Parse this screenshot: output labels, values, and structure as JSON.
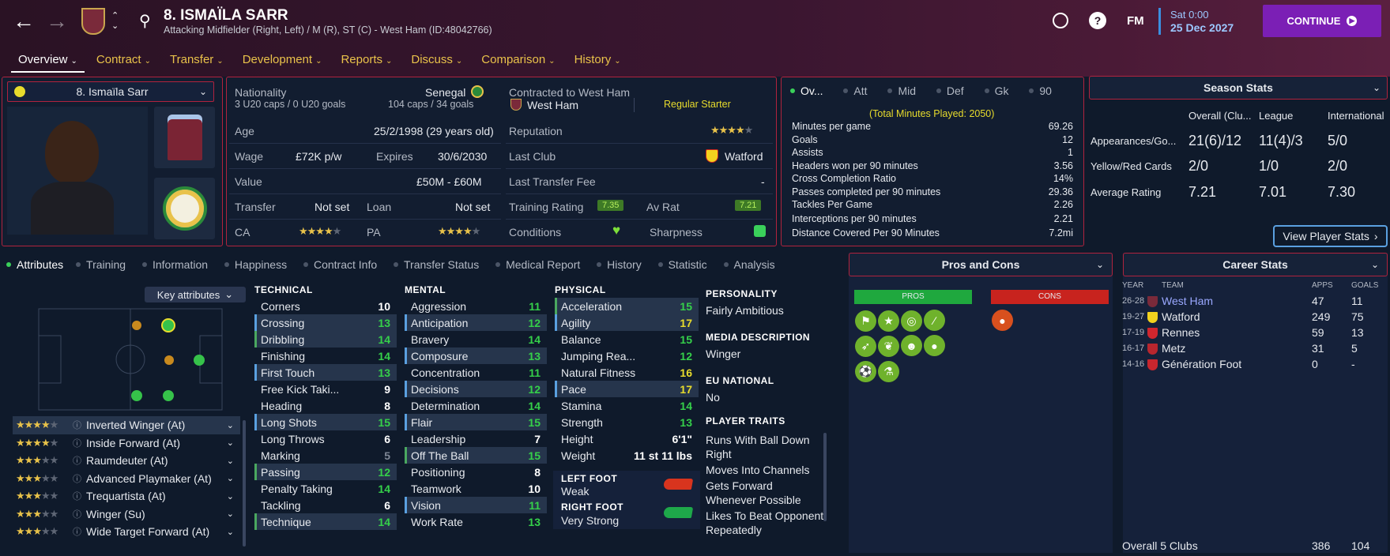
{
  "header": {
    "name": "8. ISMAÏLA SARR",
    "subtitle": "Attacking Midfielder (Right, Left) / M (R), ST (C) - West Ham (ID:48042766)",
    "fm_label": "FM",
    "date_line1": "Sat 0:00",
    "date_line2": "25 Dec 2027",
    "continue_label": "CONTINUE"
  },
  "menu": [
    {
      "label": "Overview"
    },
    {
      "label": "Contract"
    },
    {
      "label": "Transfer"
    },
    {
      "label": "Development"
    },
    {
      "label": "Reports"
    },
    {
      "label": "Discuss"
    },
    {
      "label": "Comparison"
    },
    {
      "label": "History"
    }
  ],
  "profile": {
    "select_label": "8. Ismaïla Sarr",
    "nationality_label": "Nationality",
    "nationality": "Senegal",
    "u20": "3 U20 caps / 0 U20 goals",
    "caps": "104 caps / 34 goals",
    "contracted_label": "Contracted to West Ham",
    "club": "West Ham",
    "squad_status": "Regular Starter",
    "age_label": "Age",
    "age": "25/2/1998 (29 years old)",
    "reputation_label": "Reputation",
    "wage_label": "Wage",
    "wage": "£72K p/w",
    "expires_label": "Expires",
    "expires": "30/6/2030",
    "lastclub_label": "Last Club",
    "lastclub": "Watford",
    "value_label": "Value",
    "value": "£50M - £60M",
    "lastfee_label": "Last Transfer Fee",
    "lastfee": "-",
    "transfer_label": "Transfer",
    "transfer": "Not set",
    "loan_label": "Loan",
    "loan": "Not set",
    "training_label": "Training Rating",
    "training": "7.35",
    "avrat_label": "Av Rat",
    "avrat": "7.21",
    "ca_label": "CA",
    "pa_label": "PA",
    "conditions_label": "Conditions",
    "sharpness_label": "Sharpness"
  },
  "overview_stats": {
    "tabs": [
      "Ov...",
      "Att",
      "Mid",
      "Def",
      "Gk",
      "90"
    ],
    "total": "(Total Minutes Played: 2050)",
    "rows": [
      {
        "label": "Minutes per game",
        "value": "69.26"
      },
      {
        "label": "Goals",
        "value": "12"
      },
      {
        "label": "Assists",
        "value": "1"
      },
      {
        "label": "Headers won per 90 minutes",
        "value": "3.56"
      },
      {
        "label": "Cross Completion Ratio",
        "value": "14%"
      },
      {
        "label": "Passes completed per 90 minutes",
        "value": "29.36"
      },
      {
        "label": "Tackles Per Game",
        "value": "2.26"
      },
      {
        "label": "Interceptions per 90 minutes",
        "value": "2.21"
      },
      {
        "label": "Distance Covered Per 90 Minutes",
        "value": "7.2mi"
      }
    ]
  },
  "season_stats": {
    "title": "Season Stats",
    "cols": [
      "Overall (Clu...",
      "League",
      "International"
    ],
    "rows": [
      {
        "label": "Appearances/Go...",
        "v": [
          "21(6)/12",
          "11(4)/3",
          "5/0"
        ]
      },
      {
        "label": "Yellow/Red Cards",
        "v": [
          "2/0",
          "1/0",
          "2/0"
        ]
      },
      {
        "label": "Average Rating",
        "v": [
          "7.21",
          "7.01",
          "7.30"
        ]
      }
    ],
    "button": "View Player Stats"
  },
  "subtabs": [
    "Attributes",
    "Training",
    "Information",
    "Happiness",
    "Contract Info",
    "Transfer Status",
    "Medical Report",
    "History",
    "Statistic",
    "Analysis"
  ],
  "key_attributes": "Key attributes",
  "roles": [
    {
      "name": "Inverted Winger (At)",
      "stars": 3.5
    },
    {
      "name": "Inside Forward (At)",
      "stars": 3.5
    },
    {
      "name": "Raumdeuter (At)",
      "stars": 3
    },
    {
      "name": "Advanced Playmaker (At)",
      "stars": 2.5
    },
    {
      "name": "Trequartista (At)",
      "stars": 2.5
    },
    {
      "name": "Winger (Su)",
      "stars": 2.5
    },
    {
      "name": "Wide Target Forward (At)",
      "stars": 2.5
    }
  ],
  "technical": {
    "title": "TECHNICAL",
    "rows": [
      {
        "n": "Corners",
        "v": "10",
        "c": "white",
        "h": ""
      },
      {
        "n": "Crossing",
        "v": "13",
        "c": "green",
        "h": "hb"
      },
      {
        "n": "Dribbling",
        "v": "14",
        "c": "green",
        "h": "hg"
      },
      {
        "n": "Finishing",
        "v": "14",
        "c": "green",
        "h": ""
      },
      {
        "n": "First Touch",
        "v": "13",
        "c": "green",
        "h": "hb"
      },
      {
        "n": "Free Kick Taki...",
        "v": "9",
        "c": "white",
        "h": ""
      },
      {
        "n": "Heading",
        "v": "8",
        "c": "white",
        "h": ""
      },
      {
        "n": "Long Shots",
        "v": "15",
        "c": "green",
        "h": "hb"
      },
      {
        "n": "Long Throws",
        "v": "6",
        "c": "white",
        "h": ""
      },
      {
        "n": "Marking",
        "v": "5",
        "c": "grey",
        "h": ""
      },
      {
        "n": "Passing",
        "v": "12",
        "c": "green",
        "h": "hg"
      },
      {
        "n": "Penalty Taking",
        "v": "14",
        "c": "green",
        "h": ""
      },
      {
        "n": "Tackling",
        "v": "6",
        "c": "white",
        "h": ""
      },
      {
        "n": "Technique",
        "v": "14",
        "c": "green",
        "h": "hg"
      }
    ]
  },
  "mental": {
    "title": "MENTAL",
    "rows": [
      {
        "n": "Aggression",
        "v": "11",
        "c": "green",
        "h": ""
      },
      {
        "n": "Anticipation",
        "v": "12",
        "c": "green",
        "h": "hb"
      },
      {
        "n": "Bravery",
        "v": "14",
        "c": "green",
        "h": ""
      },
      {
        "n": "Composure",
        "v": "13",
        "c": "green",
        "h": "hb"
      },
      {
        "n": "Concentration",
        "v": "11",
        "c": "green",
        "h": ""
      },
      {
        "n": "Decisions",
        "v": "12",
        "c": "green",
        "h": "hb"
      },
      {
        "n": "Determination",
        "v": "14",
        "c": "green",
        "h": ""
      },
      {
        "n": "Flair",
        "v": "15",
        "c": "green",
        "h": "hb"
      },
      {
        "n": "Leadership",
        "v": "7",
        "c": "white",
        "h": ""
      },
      {
        "n": "Off The Ball",
        "v": "15",
        "c": "green",
        "h": "hg"
      },
      {
        "n": "Positioning",
        "v": "8",
        "c": "white",
        "h": ""
      },
      {
        "n": "Teamwork",
        "v": "10",
        "c": "white",
        "h": ""
      },
      {
        "n": "Vision",
        "v": "11",
        "c": "green",
        "h": "hb"
      },
      {
        "n": "Work Rate",
        "v": "13",
        "c": "green",
        "h": ""
      }
    ]
  },
  "physical": {
    "title": "PHYSICAL",
    "rows": [
      {
        "n": "Acceleration",
        "v": "15",
        "c": "green",
        "h": "hg"
      },
      {
        "n": "Agility",
        "v": "17",
        "c": "yellow",
        "h": "hb"
      },
      {
        "n": "Balance",
        "v": "15",
        "c": "green",
        "h": ""
      },
      {
        "n": "Jumping Rea...",
        "v": "12",
        "c": "green",
        "h": ""
      },
      {
        "n": "Natural Fitness",
        "v": "16",
        "c": "yellow",
        "h": ""
      },
      {
        "n": "Pace",
        "v": "17",
        "c": "yellow",
        "h": "hb"
      },
      {
        "n": "Stamina",
        "v": "14",
        "c": "green",
        "h": ""
      },
      {
        "n": "Strength",
        "v": "13",
        "c": "green",
        "h": ""
      },
      {
        "n": "Height",
        "v": "6'1\"",
        "c": "white",
        "h": ""
      },
      {
        "n": "Weight",
        "v": "11 st 11 lbs",
        "c": "white",
        "h": ""
      }
    ],
    "left_foot_label": "LEFT FOOT",
    "left_foot": "Weak",
    "right_foot_label": "RIGHT FOOT",
    "right_foot": "Very Strong"
  },
  "personality": {
    "personality_label": "PERSONALITY",
    "personality": "Fairly Ambitious",
    "media_label": "MEDIA DESCRIPTION",
    "media": "Winger",
    "eu_label": "EU NATIONAL",
    "eu": "No",
    "traits_label": "PLAYER TRAITS",
    "traits": [
      "Runs With Ball Down Right",
      "Moves Into Channels",
      "Gets Forward Whenever Possible",
      "Likes To Beat Opponent Repeatedly"
    ]
  },
  "pros_cons": {
    "title": "Pros and Cons",
    "pros": "PROS",
    "cons": "CONS"
  },
  "career": {
    "title": "Career Stats",
    "cols": [
      "YEAR",
      "TEAM",
      "APPS",
      "GOALS"
    ],
    "rows": [
      {
        "year": "26-28",
        "team": "West Ham",
        "apps": "47",
        "goals": "11"
      },
      {
        "year": "19-27",
        "team": "Watford",
        "apps": "249",
        "goals": "75"
      },
      {
        "year": "17-19",
        "team": "Rennes",
        "apps": "59",
        "goals": "13"
      },
      {
        "year": "16-17",
        "team": "Metz",
        "apps": "31",
        "goals": "5"
      },
      {
        "year": "14-16",
        "team": "Génération Foot",
        "apps": "0",
        "goals": "-"
      }
    ],
    "total_label": "Overall 5 Clubs",
    "total_apps": "386",
    "total_goals": "104"
  },
  "colors": {
    "accent": "#7b1fb5",
    "highlight_border": "#b0233e",
    "yellow_label": "#e9c24a",
    "green_value": "#35d04a"
  }
}
